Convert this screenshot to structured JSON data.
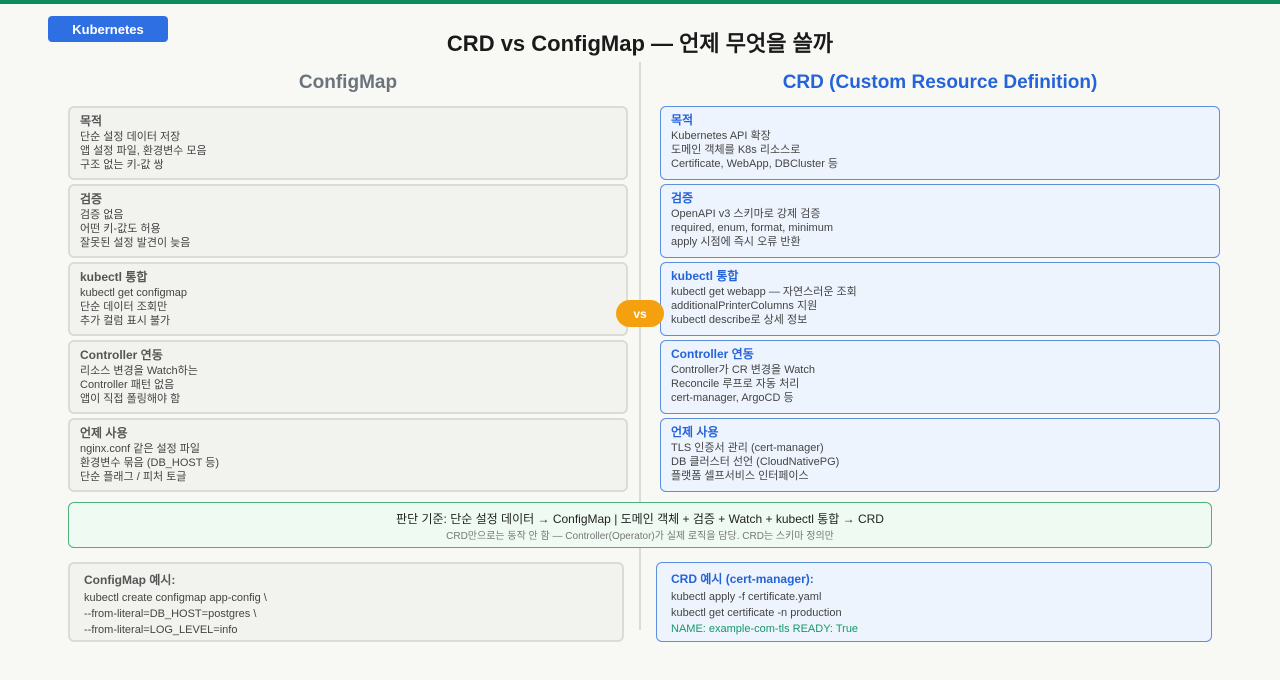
{
  "badge": "Kubernetes",
  "title": "CRD vs ConfigMap — 언제 무엇을 쓸까",
  "vs": "vs",
  "left": {
    "heading": "ConfigMap",
    "cards": [
      {
        "title": "목적",
        "lines": [
          "단순 설정 데이터 저장",
          "앱 설정 파일, 환경변수 모음",
          "구조 없는 키-값 쌍"
        ]
      },
      {
        "title": "검증",
        "lines": [
          "검증 없음",
          "어떤 키-값도 허용",
          "잘못된 설정 발견이 늦음"
        ]
      },
      {
        "title": "kubectl 통합",
        "lines": [
          "kubectl get configmap",
          "단순 데이터 조회만",
          "추가 컬럼 표시 불가"
        ]
      },
      {
        "title": "Controller 연동",
        "lines": [
          "리소스 변경을 Watch하는",
          "Controller 패턴 없음",
          "앱이 직접 폴링해야 함"
        ]
      },
      {
        "title": "언제 사용",
        "lines": [
          "nginx.conf 같은 설정 파일",
          "환경변수 묶음 (DB_HOST 등)",
          "단순 플래그 / 피처 토글"
        ]
      }
    ],
    "example": {
      "title": "ConfigMap 예시:",
      "lines": [
        "kubectl create configmap app-config \\",
        "--from-literal=DB_HOST=postgres \\",
        "--from-literal=LOG_LEVEL=info"
      ]
    }
  },
  "right": {
    "heading": "CRD (Custom Resource Definition)",
    "cards": [
      {
        "title": "목적",
        "lines": [
          "Kubernetes API 확장",
          "도메인 객체를 K8s 리소스로",
          "Certificate, WebApp, DBCluster 등"
        ]
      },
      {
        "title": "검증",
        "lines": [
          "OpenAPI v3 스키마로 강제 검증",
          "required, enum, format, minimum",
          "apply 시점에 즉시 오류 반환"
        ]
      },
      {
        "title": "kubectl 통합",
        "lines": [
          "kubectl get webapp — 자연스러운 조회",
          "additionalPrinterColumns 지원",
          "kubectl describe로 상세 정보"
        ]
      },
      {
        "title": "Controller 연동",
        "lines": [
          "Controller가 CR 변경을 Watch",
          "Reconcile 루프로 자동 처리",
          "cert-manager, ArgoCD 등"
        ]
      },
      {
        "title": "언제 사용",
        "lines": [
          "TLS 인증서 관리 (cert-manager)",
          "DB 클러스터 선언 (CloudNativePG)",
          "플랫폼 셀프서비스 인터페이스"
        ]
      }
    ],
    "example": {
      "title": "CRD 예시 (cert-manager):",
      "lines": [
        "kubectl apply -f certificate.yaml",
        "kubectl get certificate -n production"
      ],
      "output": "NAME: example-com-tls READY: True"
    }
  },
  "summary": {
    "main": "판단 기준: 단순 설정 데이터 → ConfigMap | 도메인 객체 + 검증 + Watch + kubectl 통합 → CRD",
    "note": "CRD만으로는 동작 안 함 — Controller(Operator)가 실제 로직을 담당. CRD는 스키마 정의만"
  }
}
